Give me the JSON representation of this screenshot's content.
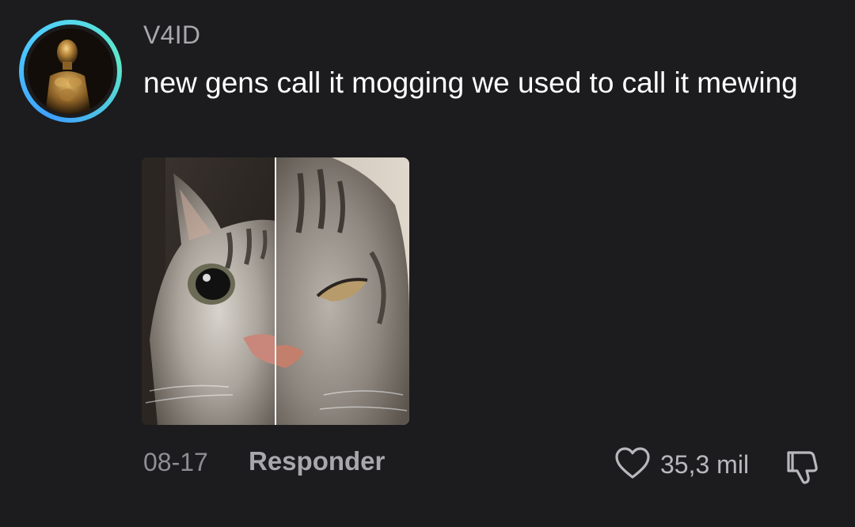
{
  "comment": {
    "username": "V4ID",
    "text": "new gens call it mogging we used to call it mewing",
    "date": "08-17",
    "reply_label": "Responder",
    "like_count": "35,3 mil",
    "avatar_ring_colors": [
      "#3ea0ff",
      "#5ee8c8"
    ],
    "icons": {
      "like": "heart-outline-icon",
      "dislike": "thumbs-down-outline-icon"
    }
  },
  "theme": {
    "background": "#1c1c1e",
    "text_primary": "#ffffff",
    "text_secondary": "#a8a8ac",
    "text_muted": "#8e8e93"
  }
}
